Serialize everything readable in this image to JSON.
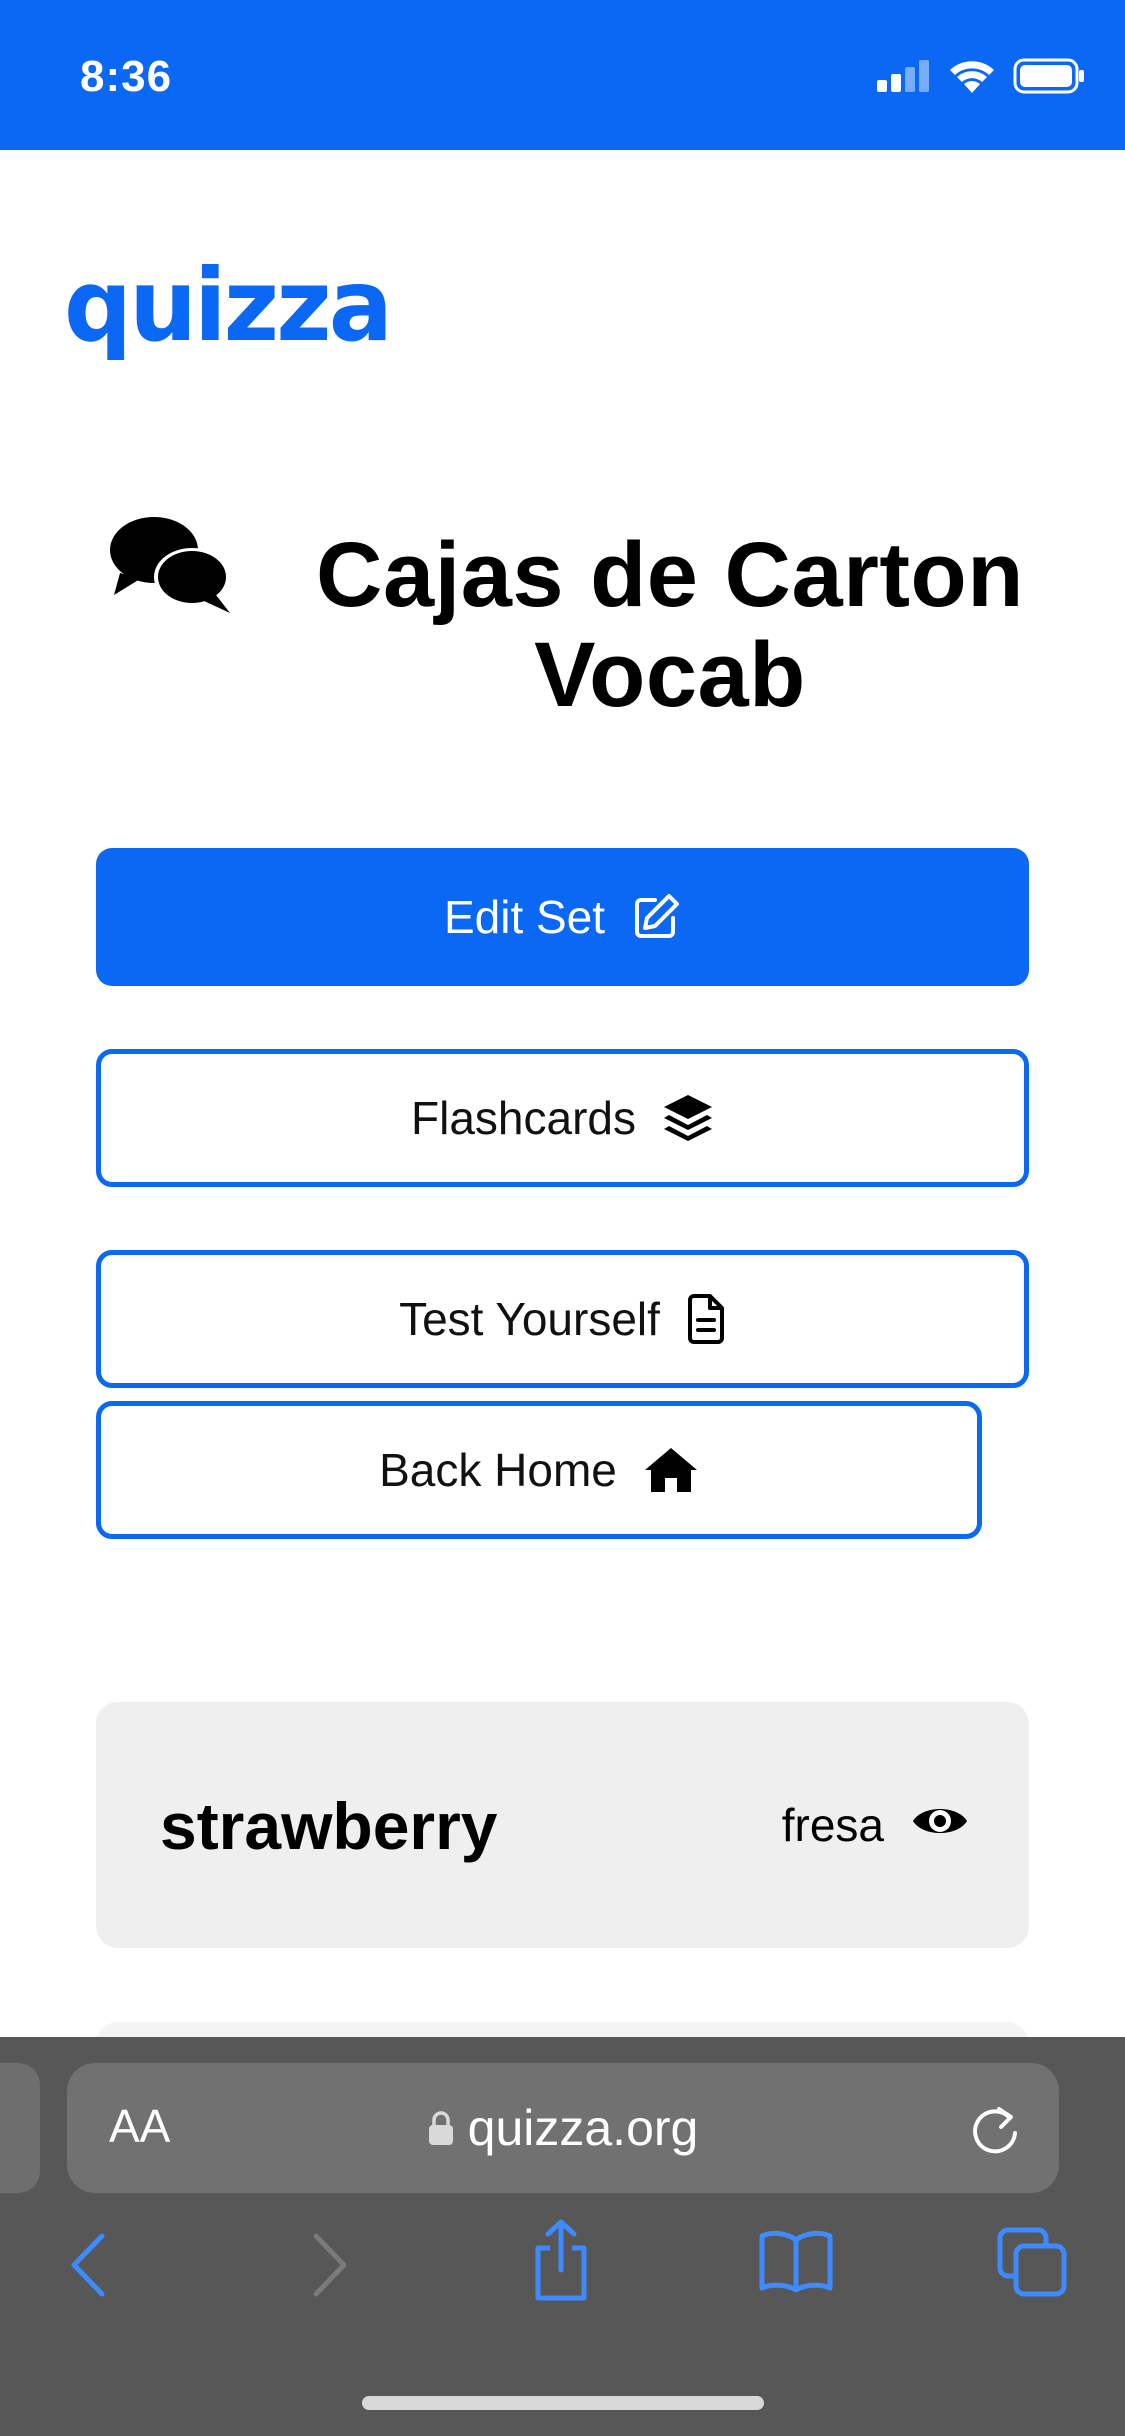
{
  "status_bar": {
    "time": "8:36"
  },
  "brand": {
    "logo_text": "quizza",
    "color": "#0a68f5"
  },
  "set": {
    "title": "Cajas de Carton Vocab"
  },
  "actions": {
    "edit_label": "Edit Set",
    "flashcards_label": "Flashcards",
    "test_label": "Test Yourself",
    "home_label": "Back Home"
  },
  "terms": [
    {
      "term": "strawberry",
      "definition": "fresa"
    }
  ],
  "browser": {
    "text_size_label": "AA",
    "url": "quizza.org"
  },
  "icons": {
    "title": "comments-icon",
    "edit": "edit-icon",
    "flashcards": "layers-icon",
    "test": "file-icon",
    "home": "home-icon",
    "reveal": "eye-icon"
  }
}
